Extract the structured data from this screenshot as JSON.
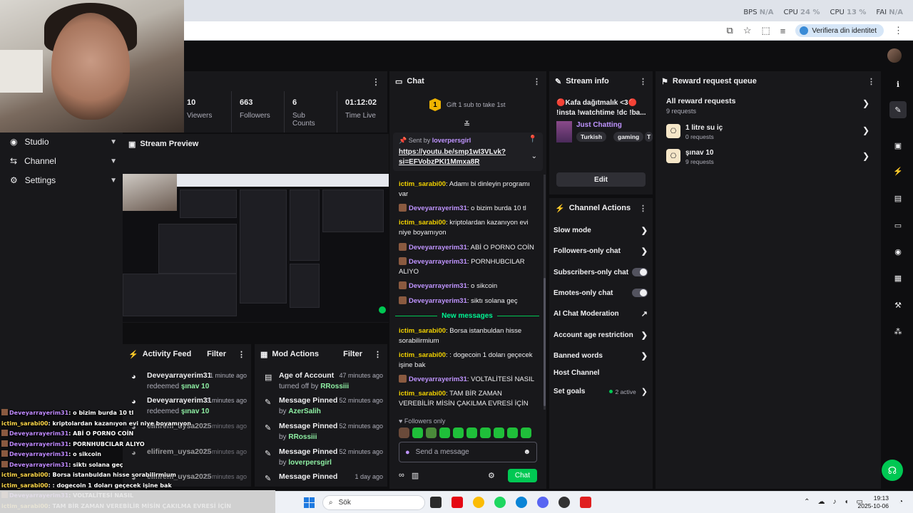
{
  "sysmon": [
    {
      "label": "BPS",
      "value": "N/A"
    },
    {
      "label": "CPU",
      "value": "24 %"
    },
    {
      "label": "CPU",
      "value": "13 %"
    },
    {
      "label": "FAI",
      "value": "N/A"
    }
  ],
  "browser": {
    "verify_label": "Verifiera din identitet"
  },
  "nav": {
    "items": [
      {
        "label": "Studio"
      },
      {
        "label": "Channel"
      },
      {
        "label": "Settings"
      }
    ]
  },
  "stats": [
    {
      "value": "10",
      "label": "Viewers"
    },
    {
      "value": "663",
      "label": "Followers"
    },
    {
      "value": "6",
      "label": "Sub Counts"
    },
    {
      "value": "01:12:02",
      "label": "Time Live"
    }
  ],
  "preview": {
    "title": "Stream Preview"
  },
  "activity": {
    "title": "Activity Feed",
    "filter": "Filter",
    "items": [
      {
        "user": "Deveyarrayerim31",
        "time": "1 minute ago",
        "action": "redeemed",
        "reward": "şınav 10"
      },
      {
        "user": "Deveyarrayerim31",
        "time": "3 minutes ago",
        "action": "redeemed",
        "reward": "şınav 10"
      },
      {
        "user": "elifirem_uysa2025",
        "time": "11 minutes ago",
        "action": "",
        "reward": ""
      },
      {
        "user": "elifirem_uysa2025",
        "time": "11 minutes ago",
        "action": "",
        "reward": ""
      },
      {
        "user": "elifirem_uysa2025",
        "time": "11 minutes ago",
        "action": "",
        "reward": ""
      }
    ]
  },
  "mod": {
    "title": "Mod Actions",
    "filter": "Filter",
    "items": [
      {
        "action": "Age of Account",
        "time": "47 minutes ago",
        "detail": "turned off by",
        "user": "RRossiii"
      },
      {
        "action": "Message Pinned",
        "time": "52 minutes ago",
        "detail": "by",
        "user": "AzerSalih"
      },
      {
        "action": "Message Pinned",
        "time": "52 minutes ago",
        "detail": "by",
        "user": "RRossiii"
      },
      {
        "action": "Message Pinned",
        "time": "52 minutes ago",
        "detail": "by",
        "user": "loverpersgirl"
      },
      {
        "action": "Message Pinned",
        "time": "1 day ago",
        "detail": "",
        "user": ""
      }
    ]
  },
  "chat": {
    "title": "Chat",
    "gift_badge": "1",
    "gift_text": "Gift 1 sub to take 1st",
    "pinned_by_label": "Sent by",
    "pinned_user": "loverpersgirl",
    "pinned_link": "https://youtu.be/smp1wI3VLvk?si=EFVobzPKI1Mmxa8R",
    "messages_before": [
      {
        "user": "ictim_sarabi00",
        "text": "Adamı bi dinleyin programı var",
        "color": "y"
      },
      {
        "user": "Deveyarrayerim31",
        "text": "o bizim burda 10 tl",
        "color": "p"
      },
      {
        "user": "ictim_sarabi00",
        "text": "kriptolardan kazanıyon evi niye boyamıyon",
        "color": "y"
      },
      {
        "user": "Deveyarrayerim31",
        "text": "ABİ O PORNO COİN",
        "color": "p"
      },
      {
        "user": "Deveyarrayerim31",
        "text": "PORNHUBCILAR ALIYO",
        "color": "p"
      },
      {
        "user": "Deveyarrayerim31",
        "text": "o sikcoin",
        "color": "p"
      },
      {
        "user": "Deveyarrayerim31",
        "text": "siktı solana geç",
        "color": "p"
      }
    ],
    "new_messages_label": "New messages",
    "messages_after": [
      {
        "user": "ictim_sarabi00",
        "text": "Borsa istanbuldan hisse sorabilirmium",
        "color": "y"
      },
      {
        "user": "ictim_sarabi00",
        "text": ": dogecoin 1 doları geçecek işine bak",
        "color": "y"
      },
      {
        "user": "Deveyarrayerim31",
        "text": "VOLTALİTESİ NASIL",
        "color": "p"
      },
      {
        "user": "ictim_sarabi00",
        "text": "TAM BİR ZAMAN VEREBİLİR MİSİN ÇAKILMA EVRESİ İÇİN",
        "color": "y"
      }
    ],
    "followers_only": "Followers only",
    "input_placeholder": "Send a message",
    "send_label": "Chat"
  },
  "stream_info": {
    "title": "Stream info",
    "stream_title": "🔴Kafa dağıtmalık <3🔴 !insta !watchtime !dc !ba...",
    "category": "Just Chatting",
    "tags": [
      "Turkish",
      "gaming",
      "T"
    ],
    "edit_label": "Edit"
  },
  "channel_actions": {
    "title": "Channel Actions",
    "items": [
      {
        "label": "Slow mode",
        "control": "chevron"
      },
      {
        "label": "Followers-only chat",
        "control": "chevron"
      },
      {
        "label": "Subscribers-only chat",
        "control": "toggle"
      },
      {
        "label": "Emotes-only chat",
        "control": "toggle"
      },
      {
        "label": "AI Chat Moderation",
        "control": "external"
      },
      {
        "label": "Account age restriction",
        "control": "chevron"
      },
      {
        "label": "Banned words",
        "control": "chevron"
      },
      {
        "label": "Host Channel",
        "control": "none"
      },
      {
        "label": "Set goals",
        "control": "active",
        "extra": "2 active"
      }
    ]
  },
  "reward_queue": {
    "title": "Reward request queue",
    "all_label": "All reward requests",
    "all_count": "9 requests",
    "items": [
      {
        "title": "1 litre su iç",
        "count": "0 requests"
      },
      {
        "title": "şınav 10",
        "count": "9 requests"
      }
    ]
  },
  "overlay_chat": [
    {
      "user": "Deveyarrayerim31",
      "text": ": o bizim burda 10 tl",
      "color": "p",
      "av": true
    },
    {
      "user": "ictim_sarabi00",
      "text": ": kriptolardan kazanıyon evi niye boyamıyon",
      "color": "y",
      "av": false
    },
    {
      "user": "Deveyarrayerim31",
      "text": ": ABİ O PORNO COİN",
      "color": "p",
      "av": true
    },
    {
      "user": "Deveyarrayerim31",
      "text": ": PORNHUBCILAR ALIYO",
      "color": "p",
      "av": true
    },
    {
      "user": "Deveyarrayerim31",
      "text": ": o sikcoin",
      "color": "p",
      "av": true
    },
    {
      "user": "Deveyarrayerim31",
      "text": ": siktı solana geç",
      "color": "p",
      "av": true
    },
    {
      "user": "ictim_sarabi00",
      "text": ": Borsa istanbuldan hisse sorabilirmium",
      "color": "y",
      "av": false
    },
    {
      "user": "ictim_sarabi00",
      "text": ": : dogecoin 1 doları geçecek işine bak",
      "color": "y",
      "av": false
    },
    {
      "user": "Deveyarrayerim31",
      "text": ": VOLTALİTESİ NASIL",
      "color": "p",
      "av": true
    },
    {
      "user": "ictim_sarabi00",
      "text": ": TAM BİR ZAMAN VEREBİLİR MİSİN ÇAKILMA EVRESİ İÇİN",
      "color": "y",
      "av": false
    }
  ],
  "taskbar": {
    "search_label": "Sök",
    "time": "19:13",
    "date": "2025-10-06"
  },
  "colors": {
    "accent_green": "#00c853",
    "purple": "#bf94ff",
    "panel_bg": "#18181b",
    "page_bg": "#0e0e10"
  }
}
